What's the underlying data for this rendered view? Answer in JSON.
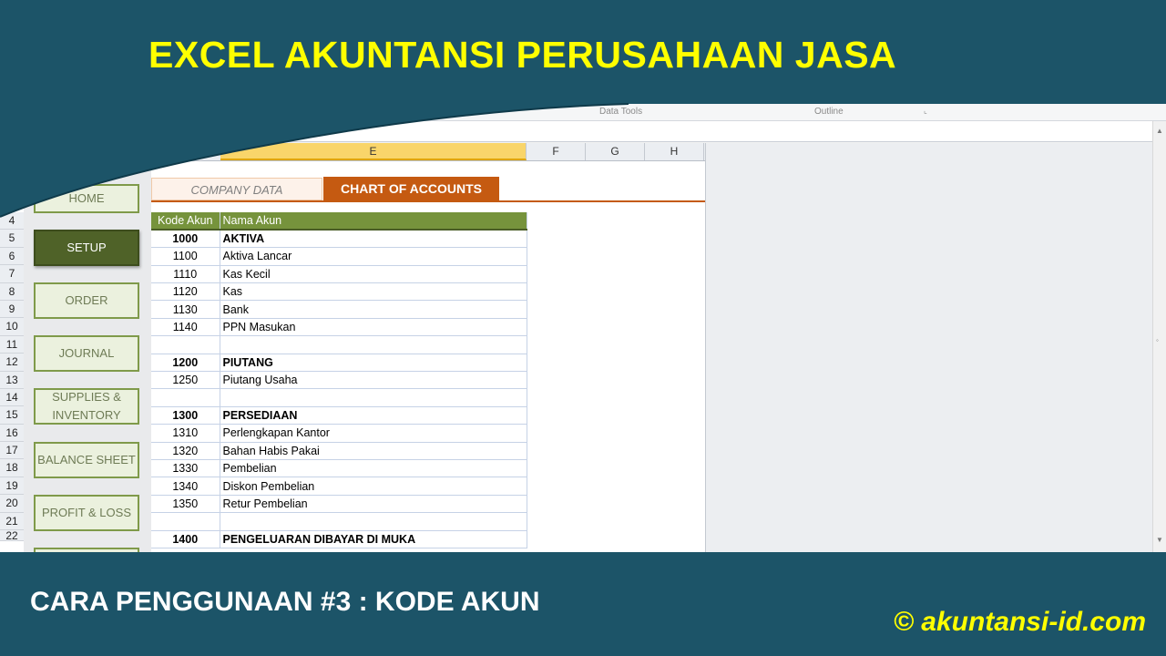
{
  "banner": {
    "title": "EXCEL AKUNTANSI PERUSAHAAN JASA",
    "subtitle": "CARA PENGGUNAAN #3 : KODE AKUN",
    "watermark": "© akuntansi-id.com",
    "colors": {
      "banner_bg": "#1c5468",
      "title": "#ffff00",
      "watermark": "#ffff00"
    }
  },
  "ribbon": {
    "groups": [
      "Data Tools",
      "Outline"
    ]
  },
  "columns": [
    "E",
    "F",
    "G",
    "H"
  ],
  "row_numbers": [
    "4",
    "5",
    "6",
    "7",
    "8",
    "9",
    "10",
    "11",
    "12",
    "13",
    "14",
    "15",
    "16",
    "17",
    "18",
    "19",
    "20",
    "21",
    "22"
  ],
  "nav": {
    "home_label": "HOME",
    "items": [
      {
        "label": "SETUP",
        "active": true
      },
      {
        "label": "ORDER"
      },
      {
        "label": "JOURNAL"
      },
      {
        "label": "SUPPLIES &\nINVENTORY"
      },
      {
        "label": "BALANCE SHEET"
      },
      {
        "label": "PROFIT & LOSS"
      }
    ]
  },
  "tabs": {
    "company_data": "COMPANY DATA",
    "chart_of_accounts": "CHART OF ACCOUNTS"
  },
  "table": {
    "headers": {
      "code": "Kode Akun",
      "name": "Nama Akun"
    },
    "rows": [
      {
        "code": "1000",
        "name": "AKTIVA",
        "bold": true
      },
      {
        "code": "1100",
        "name": "Aktiva Lancar"
      },
      {
        "code": "1110",
        "name": "Kas Kecil"
      },
      {
        "code": "1120",
        "name": "Kas"
      },
      {
        "code": "1130",
        "name": "Bank"
      },
      {
        "code": "1140",
        "name": "PPN Masukan"
      },
      {
        "code": "",
        "name": ""
      },
      {
        "code": "1200",
        "name": "PIUTANG",
        "bold": true
      },
      {
        "code": "1250",
        "name": "Piutang Usaha"
      },
      {
        "code": "",
        "name": ""
      },
      {
        "code": "1300",
        "name": "PERSEDIAAN",
        "bold": true
      },
      {
        "code": "1310",
        "name": "Perlengkapan Kantor"
      },
      {
        "code": "1320",
        "name": "Bahan Habis Pakai"
      },
      {
        "code": "1330",
        "name": "Pembelian"
      },
      {
        "code": "1340",
        "name": "Diskon Pembelian"
      },
      {
        "code": "1350",
        "name": "Retur Pembelian"
      },
      {
        "code": "",
        "name": ""
      },
      {
        "code": "1400",
        "name": "PENGELUARAN DIBAYAR DI MUKA",
        "bold": true
      }
    ]
  }
}
